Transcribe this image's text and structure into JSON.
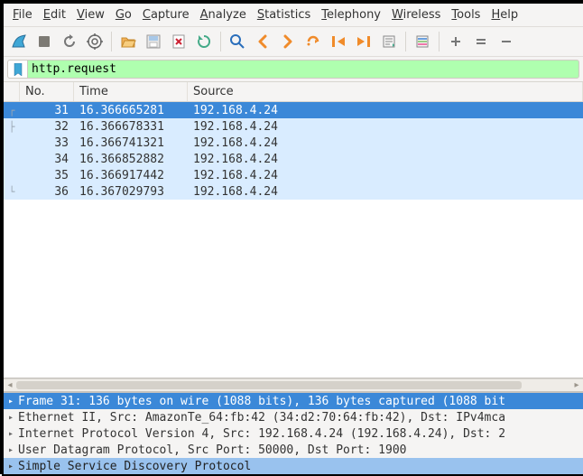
{
  "menu": {
    "groups": [
      {
        "label": "File",
        "accel": "F"
      },
      {
        "label": "Edit",
        "accel": "E"
      },
      {
        "label": "View",
        "accel": "V"
      },
      {
        "label": "Go",
        "accel": "G"
      },
      {
        "label": "Capture",
        "accel": "C"
      },
      {
        "label": "Analyze",
        "accel": "A"
      },
      {
        "label": "Statistics",
        "accel": "S"
      },
      {
        "label": "Telephony",
        "accel": "T"
      },
      {
        "label": "Wireless",
        "accel": "W"
      },
      {
        "label": "Tools",
        "accel": "T"
      },
      {
        "label": "Help",
        "accel": "H"
      }
    ]
  },
  "toolbar": {
    "buttons": [
      "shark-fin-icon",
      "stop-icon",
      "restart-icon",
      "options-icon",
      "|",
      "open-icon",
      "save-icon",
      "close-file-icon",
      "reload-icon",
      "|",
      "find-icon",
      "nav-back-icon",
      "nav-forward-icon",
      "jump-icon",
      "goto-first-icon",
      "goto-last-icon",
      "autoscroll-icon",
      "|",
      "colorize-icon",
      "|",
      "zoom-in-icon",
      "zoom-reset-icon",
      "zoom-out-icon"
    ]
  },
  "filter": {
    "value": "http.request",
    "bookmark_icon": "bookmark-icon"
  },
  "packet_list": {
    "columns": [
      "No.",
      "Time",
      "Source"
    ],
    "rows": [
      {
        "no": "31",
        "time": "16.366665281",
        "source": "192.168.4.24",
        "tree": "top",
        "selected": true
      },
      {
        "no": "32",
        "time": "16.366678331",
        "source": "192.168.4.24",
        "tree": "mid"
      },
      {
        "no": "33",
        "time": "16.366741321",
        "source": "192.168.4.24",
        "tree": "none"
      },
      {
        "no": "34",
        "time": "16.366852882",
        "source": "192.168.4.24",
        "tree": "none"
      },
      {
        "no": "35",
        "time": "16.366917442",
        "source": "192.168.4.24",
        "tree": "none"
      },
      {
        "no": "36",
        "time": "16.367029793",
        "source": "192.168.4.24",
        "tree": "end"
      }
    ]
  },
  "details": [
    {
      "text": "Frame 31: 136 bytes on wire (1088 bits), 136 bytes captured (1088 bit",
      "sel": "sel1"
    },
    {
      "text": "Ethernet II, Src: AmazonTe_64:fb:42 (34:d2:70:64:fb:42), Dst: IPv4mca"
    },
    {
      "text": "Internet Protocol Version 4, Src: 192.168.4.24 (192.168.4.24), Dst: 2"
    },
    {
      "text": "User Datagram Protocol, Src Port: 50000, Dst Port: 1900"
    },
    {
      "text": "Simple Service Discovery Protocol",
      "sel": "sel2"
    }
  ],
  "colors": {
    "selected_row": "#3b88d8",
    "alt_row": "#d9ecff",
    "filter_valid": "#afffaf",
    "accent_orange": "#f08b2a"
  }
}
